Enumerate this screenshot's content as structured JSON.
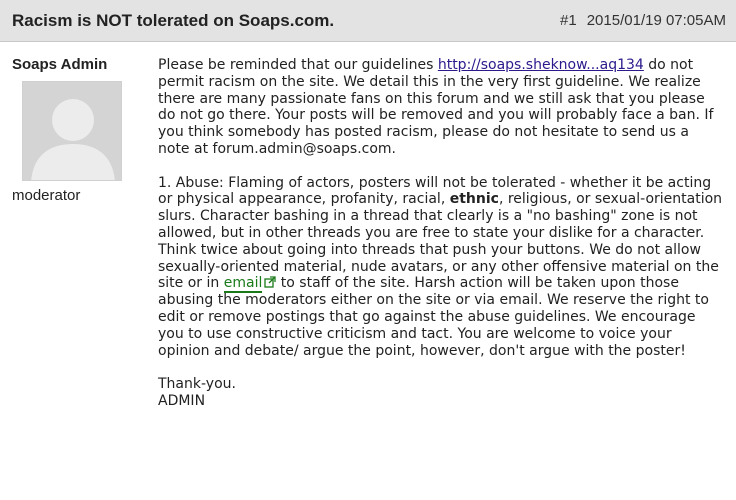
{
  "post": {
    "title": "Racism is NOT tolerated on Soaps.com.",
    "number": "#1",
    "datetime": "2015/01/19 07:05AM"
  },
  "author": {
    "name": "Soaps Admin",
    "role": "moderator",
    "avatar_icon": "default-user-silhouette-icon"
  },
  "message": {
    "p1_a": "Please be reminded that our guidelines ",
    "p1_link": "http://soaps.sheknow...aq134",
    "p1_b": " do not permit racism on the site. We detail this in the very first guideline. We realize there are many passionate fans on this forum and we still ask that you please do not go there. Your posts will be removed and you will probably face a ban. If you think somebody has posted racism, please do not hesitate to send us a note at forum.admin@soaps.com.",
    "p2_a": "1. Abuse: Flaming of actors, posters will not be tolerated - whether it be acting or physical appearance, profanity, racial, ",
    "p2_bold": "ethnic",
    "p2_b": ", religious, or sexual-orientation slurs. Character bashing in a thread that clearly is a \"no bashing\" zone is not allowed, but in other threads you are free to state your dislike for a character. Think twice about going into threads that push your buttons. We do not allow sexually-oriented material, nude avatars, or any other offensive material on the site or in ",
    "p2_link": "email",
    "p2_c": " to staff of the site. Harsh action will be taken upon those abusing the moderators either on the site or via email. We reserve the right to edit or remove postings that go against the abuse guidelines. We encourage you to use constructive criticism and tact. You are welcome to voice your opinion and debate/ argue the point, however, don't argue with the poster!",
    "sign1": "Thank-you.",
    "sign2": "ADMIN"
  },
  "colors": {
    "header_bg": "#e3e3e3",
    "guideline_link": "#2a1a8c",
    "email_link": "#1a7a1a"
  }
}
